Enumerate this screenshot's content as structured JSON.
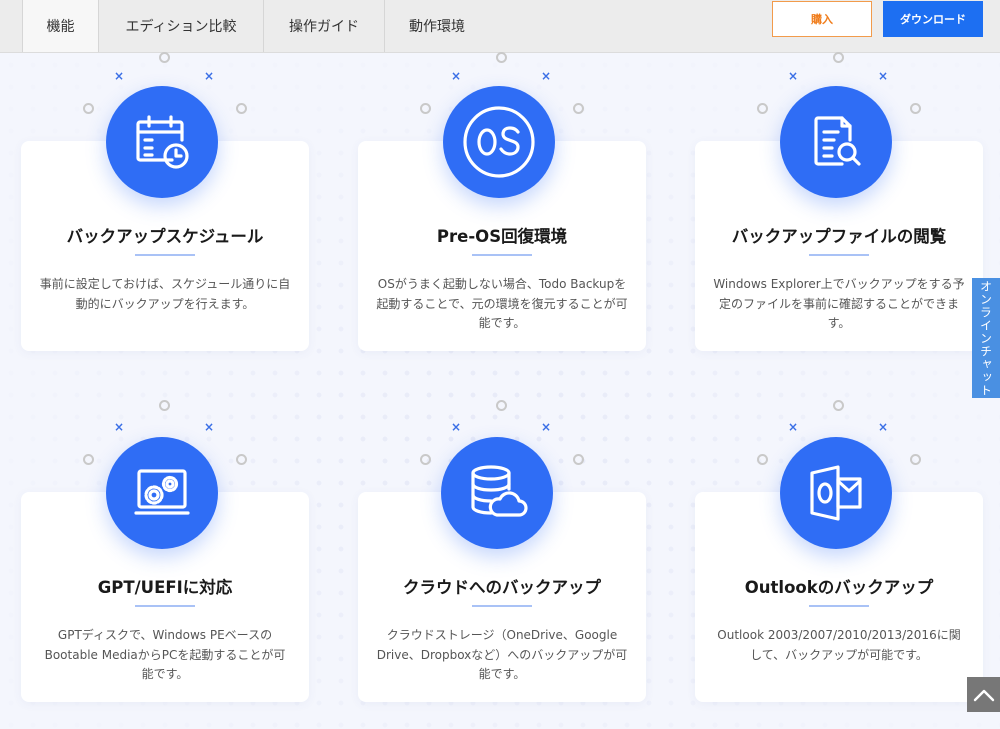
{
  "nav": {
    "tabs": [
      {
        "label": "機能",
        "active": true
      },
      {
        "label": "エディション比較",
        "active": false
      },
      {
        "label": "操作ガイド",
        "active": false
      },
      {
        "label": "動作環境",
        "active": false
      }
    ],
    "buy_label": "購入",
    "download_label": "ダウンロード"
  },
  "colors": {
    "accent": "#2f6df5",
    "buy_border": "#f29b4b",
    "download_bg": "#1d6ff2",
    "chat_tab": "#4a90e2"
  },
  "features": [
    {
      "icon": "calendar-clock-icon",
      "title": "バックアップスケジュール",
      "desc": "事前に設定しておけば、スケジュール通りに自動的にバックアップを行えます。"
    },
    {
      "icon": "os-icon",
      "title": "Pre-OS回復環境",
      "desc": "OSがうまく起動しない場合、Todo Backupを起動することで、元の環境を復元することが可能です。"
    },
    {
      "icon": "document-search-icon",
      "title": "バックアップファイルの閲覧",
      "desc": "Windows Explorer上でバックアップをする予定のファイルを事前に確認することができます。"
    },
    {
      "icon": "gears-screen-icon",
      "title": "GPT/UEFIに対応",
      "desc": "GPTディスクで、Windows PEベースのBootable MediaからPCを起動することが可能です。"
    },
    {
      "icon": "database-cloud-icon",
      "title": "クラウドへのバックアップ",
      "desc": "クラウドストレージ（OneDrive、Google Drive、Dropboxなど）へのバックアップが可能です。"
    },
    {
      "icon": "outlook-icon",
      "title": "Outlookのバックアップ",
      "desc": "Outlook 2003/2007/2010/2013/2016に関して、バックアップが可能です。"
    }
  ],
  "side": {
    "chat_label": "オンラインチャット",
    "back_to_top_icon": "chevron-up-icon"
  }
}
